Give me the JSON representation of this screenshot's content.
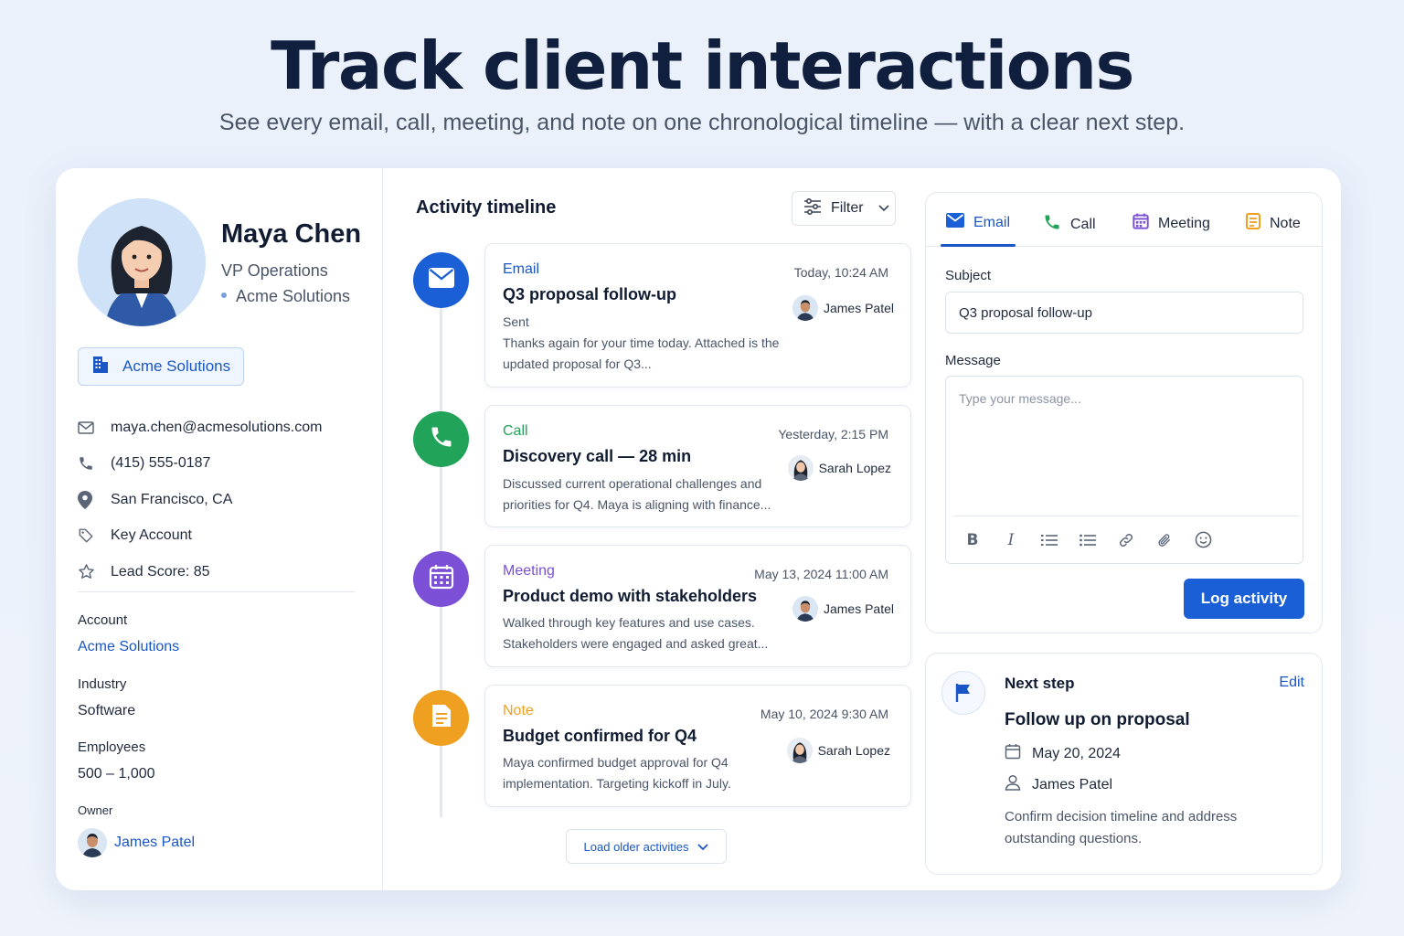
{
  "hero": {
    "title": "Track client interactions",
    "subtitle": "See every email, call, meeting, and note on one chronological timeline — with a clear next step."
  },
  "colors": {
    "primary": "#1a5fd6",
    "email": "#1a5fd6",
    "call": "#22a35a",
    "meeting": "#7b4fd6",
    "note": "#f0a020"
  },
  "contact": {
    "name": "Maya Chen",
    "role": "VP Operations",
    "company": "Acme Solutions",
    "company_chip": "Acme Solutions",
    "email": "maya.chen@acmesolutions.com",
    "phone": "(415) 555-0187",
    "location": "San Francisco, CA",
    "tag": "Key Account",
    "lead_score": "Lead Score: 85",
    "account_label": "Account",
    "account_value": "Acme Solutions",
    "industry_label": "Industry",
    "industry_value": "Software",
    "employees_label": "Employees",
    "employees_value": "500 – 1,000",
    "owner_label": "Owner",
    "owner_name": "James Patel"
  },
  "timeline": {
    "title": "Activity timeline",
    "filter_label": "Filter",
    "load_more": "Load older activities",
    "activities": [
      {
        "type": "Email",
        "time": "Today, 10:24 AM",
        "title": "Q3 proposal follow-up",
        "status": "Sent",
        "body": "Thanks again for your time today. Attached is the updated proposal for Q3...",
        "person": "James Patel",
        "icon": "envelope-icon"
      },
      {
        "type": "Call",
        "time": "Yesterday, 2:15 PM",
        "title": "Discovery call — 28 min",
        "body": "Discussed current operational challenges and priorities for Q4. Maya is aligning with finance...",
        "person": "Sarah Lopez",
        "icon": "phone-icon"
      },
      {
        "type": "Meeting",
        "time": "May 13, 2024  11:00 AM",
        "title": "Product demo with stakeholders",
        "body": "Walked through key features and use cases. Stakeholders were engaged and asked great...",
        "person": "James Patel",
        "icon": "calendar-icon"
      },
      {
        "type": "Note",
        "time": "May 10, 2024  9:30 AM",
        "title": "Budget confirmed for Q4",
        "body": "Maya confirmed budget approval for Q4 implementation. Targeting kickoff in July.",
        "person": "Sarah Lopez",
        "icon": "note-icon"
      }
    ]
  },
  "compose": {
    "tabs": [
      "Email",
      "Call",
      "Meeting",
      "Note"
    ],
    "active_tab": "Email",
    "subject_label": "Subject",
    "subject_value": "Q3 proposal follow-up",
    "message_label": "Message",
    "message_placeholder": "Type your message...",
    "submit_label": "Log activity"
  },
  "next_step": {
    "title": "Next step",
    "edit_label": "Edit",
    "task": "Follow up on proposal",
    "date": "May 20, 2024",
    "assignee": "James Patel",
    "description": "Confirm decision timeline and address outstanding questions."
  }
}
